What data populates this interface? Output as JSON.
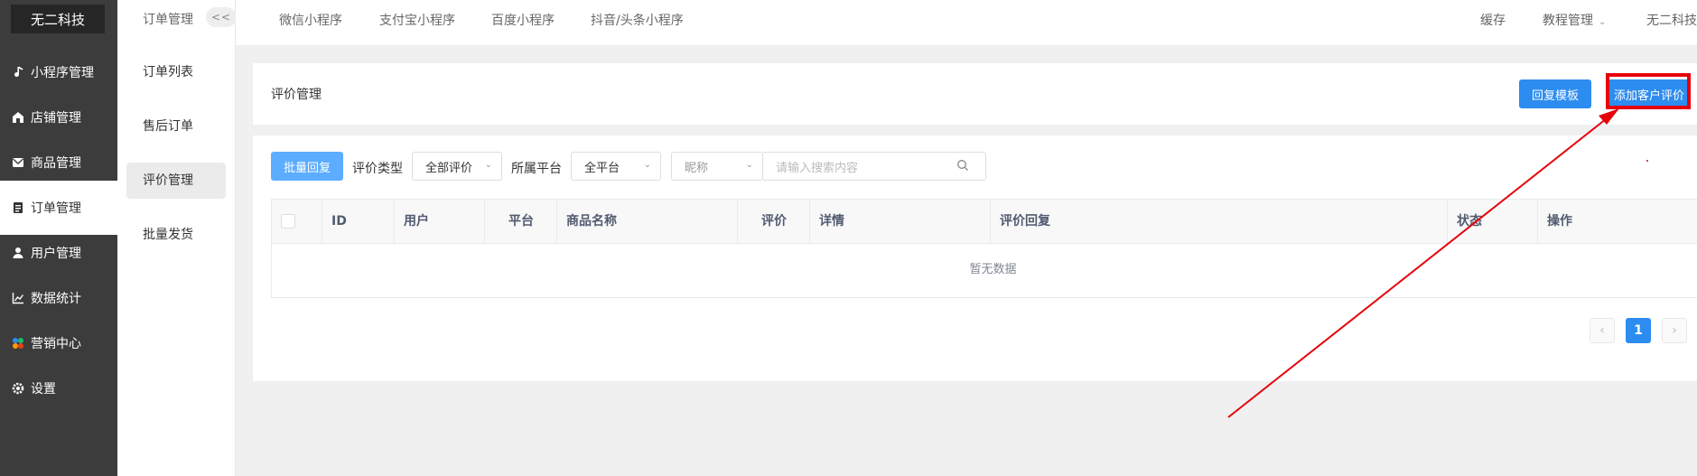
{
  "brand": "无二科技",
  "sidebar": {
    "items": [
      {
        "label": "小程序管理",
        "icon": "music-note-icon"
      },
      {
        "label": "店铺管理",
        "icon": "store-icon"
      },
      {
        "label": "商品管理",
        "icon": "mail-box-icon"
      },
      {
        "label": "订单管理",
        "icon": "order-list-icon"
      },
      {
        "label": "用户管理",
        "icon": "user-icon"
      },
      {
        "label": "数据统计",
        "icon": "chart-icon"
      },
      {
        "label": "营销中心",
        "icon": "marketing-icon"
      },
      {
        "label": "设置",
        "icon": "gear-icon"
      }
    ],
    "active_index": 3
  },
  "submenu": {
    "title": "订单管理",
    "collapse": "<<",
    "items": [
      "订单列表",
      "售后订单",
      "评价管理",
      "批量发货"
    ],
    "active_index": 2
  },
  "topnav": {
    "tabs": [
      "微信小程序",
      "支付宝小程序",
      "百度小程序",
      "抖音/头条小程序"
    ],
    "right": {
      "cache": "缓存",
      "tutorial": "教程管理",
      "company": "无二科技"
    }
  },
  "header": {
    "title": "评价管理",
    "reply_template_button": "回复模板",
    "add_review_button": "添加客户评价"
  },
  "filters": {
    "batch_reply_button": "批量回复",
    "rating_type_label": "评价类型",
    "rating_type_value": "全部评价",
    "platform_label": "所属平台",
    "platform_value": "全平台",
    "field_select_value": "昵称",
    "search_placeholder": "请输入搜索内容"
  },
  "table": {
    "columns": [
      "ID",
      "用户",
      "平台",
      "商品名称",
      "评价",
      "详情",
      "评价回复",
      "状态",
      "操作"
    ],
    "empty_text": "暂无数据"
  },
  "pagination": {
    "prev": "‹",
    "current_page": "1",
    "next": "›"
  },
  "colors": {
    "primary": "#2d8cf0",
    "annotation": "#e6000a",
    "sidebar": "#3c3c3c"
  }
}
